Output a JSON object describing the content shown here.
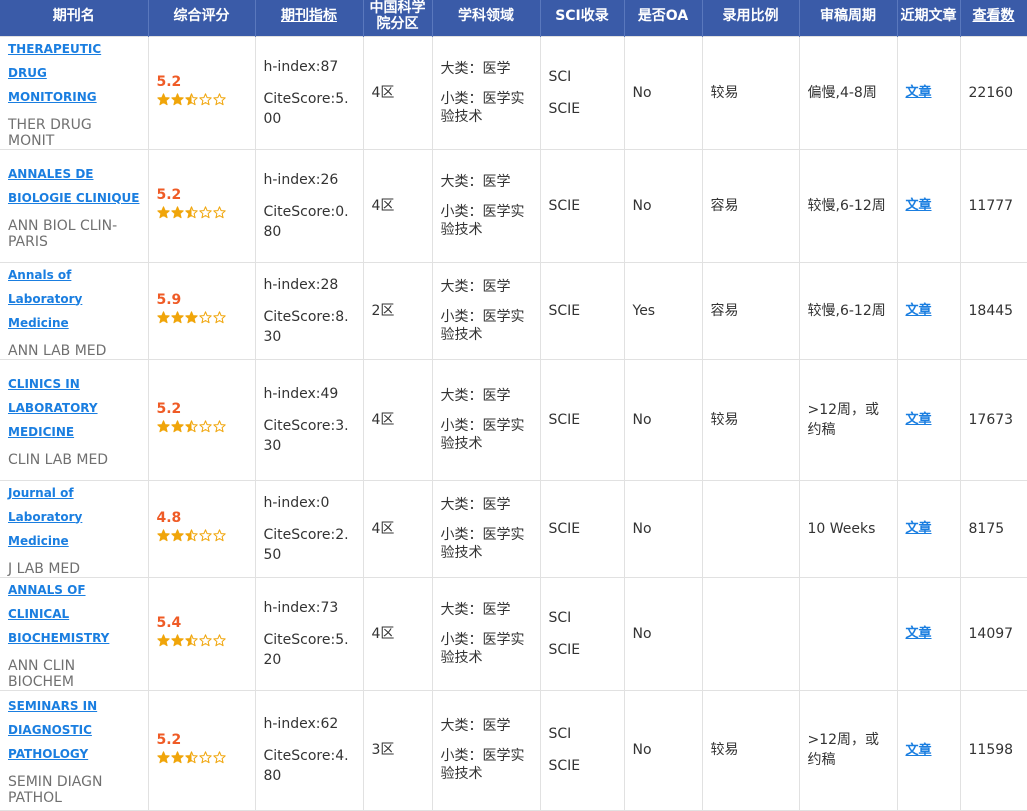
{
  "colors": {
    "header_bg": "#3a5ba8",
    "link": "#1a7ee0",
    "score": "#ef5b26",
    "star": "#f0a50a"
  },
  "header": {
    "name": "期刊名",
    "rating": "综合评分",
    "metrics": "期刊指标",
    "cas_zone": "中国科学院分区",
    "field": "学科领域",
    "sci": "SCI收录",
    "oa": "是否OA",
    "acceptance": "录用比例",
    "review": "审稿周期",
    "recent": "近期文章",
    "views": "查看数"
  },
  "rows": [
    {
      "name": "THERAPEUTIC DRUG MONITORING",
      "abbr": "THER DRUG MONIT",
      "score": "5.2",
      "stars": 2.5,
      "h_index": "h-index:87",
      "citescore": "CiteScore:5.00",
      "zone": "4区",
      "major": "大类：医学",
      "minor": "小类：医学实验技术",
      "sci": [
        "SCI",
        "SCIE"
      ],
      "oa": "No",
      "acceptance": "较易",
      "review": "偏慢,4-8周",
      "article": "文章",
      "views": "22160"
    },
    {
      "name": "ANNALES DE BIOLOGIE CLINIQUE",
      "abbr": "ANN BIOL CLIN-PARIS",
      "score": "5.2",
      "stars": 2.5,
      "h_index": "h-index:26",
      "citescore": "CiteScore:0.80",
      "zone": "4区",
      "major": "大类：医学",
      "minor": "小类：医学实验技术",
      "sci": [
        "SCIE"
      ],
      "oa": "No",
      "acceptance": "容易",
      "review": "较慢,6-12周",
      "article": "文章",
      "views": "11777"
    },
    {
      "name": "Annals of Laboratory Medicine",
      "abbr": "ANN LAB MED",
      "score": "5.9",
      "stars": 3,
      "h_index": "h-index:28",
      "citescore": "CiteScore:8.30",
      "zone": "2区",
      "major": "大类：医学",
      "minor": "小类：医学实验技术",
      "sci": [
        "SCIE"
      ],
      "oa": "Yes",
      "acceptance": "容易",
      "review": "较慢,6-12周",
      "article": "文章",
      "views": "18445"
    },
    {
      "name": "CLINICS IN LABORATORY MEDICINE",
      "abbr": "CLIN LAB MED",
      "score": "5.2",
      "stars": 2.5,
      "h_index": "h-index:49",
      "citescore": "CiteScore:3.30",
      "zone": "4区",
      "major": "大类：医学",
      "minor": "小类：医学实验技术",
      "sci": [
        "SCIE"
      ],
      "oa": "No",
      "acceptance": "较易",
      "review": ">12周，或约稿",
      "article": "文章",
      "views": "17673"
    },
    {
      "name": "Journal of Laboratory Medicine",
      "abbr": "J LAB MED",
      "score": "4.8",
      "stars": 2.5,
      "h_index": "h-index:0",
      "citescore": "CiteScore:2.50",
      "zone": "4区",
      "major": "大类：医学",
      "minor": "小类：医学实验技术",
      "sci": [
        "SCIE"
      ],
      "oa": "No",
      "acceptance": "",
      "review": "10 Weeks",
      "article": "文章",
      "views": "8175"
    },
    {
      "name": "ANNALS OF CLINICAL BIOCHEMISTRY",
      "abbr": "ANN CLIN BIOCHEM",
      "score": "5.4",
      "stars": 2.5,
      "h_index": "h-index:73",
      "citescore": "CiteScore:5.20",
      "zone": "4区",
      "major": "大类：医学",
      "minor": "小类：医学实验技术",
      "sci": [
        "SCI",
        "SCIE"
      ],
      "oa": "No",
      "acceptance": "",
      "review": "",
      "article": "文章",
      "views": "14097"
    },
    {
      "name": "SEMINARS IN DIAGNOSTIC PATHOLOGY",
      "abbr": "SEMIN DIAGN PATHOL",
      "score": "5.2",
      "stars": 2.5,
      "h_index": "h-index:62",
      "citescore": "CiteScore:4.80",
      "zone": "3区",
      "major": "大类：医学",
      "minor": "小类：医学实验技术",
      "sci": [
        "SCI",
        "SCIE"
      ],
      "oa": "No",
      "acceptance": "较易",
      "review": ">12周，或约稿",
      "article": "文章",
      "views": "11598"
    }
  ]
}
